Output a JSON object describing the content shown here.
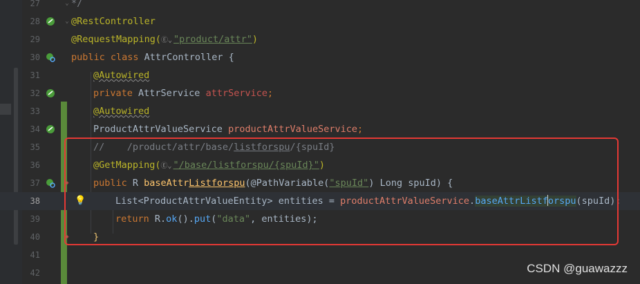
{
  "lines": [
    {
      "no": "27",
      "type": "comment_end"
    },
    {
      "no": "28",
      "type": "rest"
    },
    {
      "no": "29",
      "type": "reqmap"
    },
    {
      "no": "30",
      "type": "classdef"
    },
    {
      "no": "31",
      "type": "autowired1"
    },
    {
      "no": "32",
      "type": "attrservice"
    },
    {
      "no": "33",
      "type": "autowired2"
    },
    {
      "no": "34",
      "type": "pavservice"
    },
    {
      "no": "35",
      "type": "comment"
    },
    {
      "no": "36",
      "type": "getmapping"
    },
    {
      "no": "37",
      "type": "methoddef"
    },
    {
      "no": "38",
      "type": "entities"
    },
    {
      "no": "39",
      "type": "return"
    },
    {
      "no": "40",
      "type": "closebrace"
    },
    {
      "no": "41",
      "type": "empty"
    },
    {
      "no": "42",
      "type": "empty"
    }
  ],
  "code": {
    "l27": "*/",
    "l28": "@RestController",
    "l29_a": "@RequestMapping(",
    "l29_b": "\"product/attr\"",
    "l29_c": ")",
    "l30_kw": "public class",
    "l30_name": " AttrController {",
    "l31": "@Autowired",
    "l32_kw": "private",
    "l32_type": " AttrService ",
    "l32_field": "attrService",
    "l32_end": ";",
    "l33": "@Autowired",
    "l34_type": "ProductAttrValueService ",
    "l34_field": "productAttrValueService",
    "l34_end": ";",
    "l35_a": "//    /product/attr/base/",
    "l35_b": "listforspu",
    "l35_c": "/{spuId}",
    "l36_a": "@GetMapping(",
    "l36_b": "\"/base/listforspu/{spuId}\"",
    "l36_c": ")",
    "l37_kw": "public",
    "l37_r": " R ",
    "l37_fn_a": "baseAttr",
    "l37_fn_b": "Listforspu",
    "l37_p1": "(@PathVariable(",
    "l37_s": "\"spuId\"",
    "l37_p2": ") Long spuId) {",
    "l38_a": "List<ProductAttrValueEntity> entities = ",
    "l38_field": "productAttrValueService",
    "l38_dot": ".",
    "l38_m1": "baseAttrListf",
    "l38_m2": "orspu",
    "l38_end": "(spuId);",
    "l39_kw": "return",
    "l39_a": " R.",
    "l39_ok": "ok",
    "l39_b": "().",
    "l39_put": "put",
    "l39_c": "(",
    "l39_s": "\"data\"",
    "l39_d": ", entities);",
    "l40": "}",
    "globe": "Ⓔ⌄"
  },
  "watermark": "CSDN @guawazzz"
}
